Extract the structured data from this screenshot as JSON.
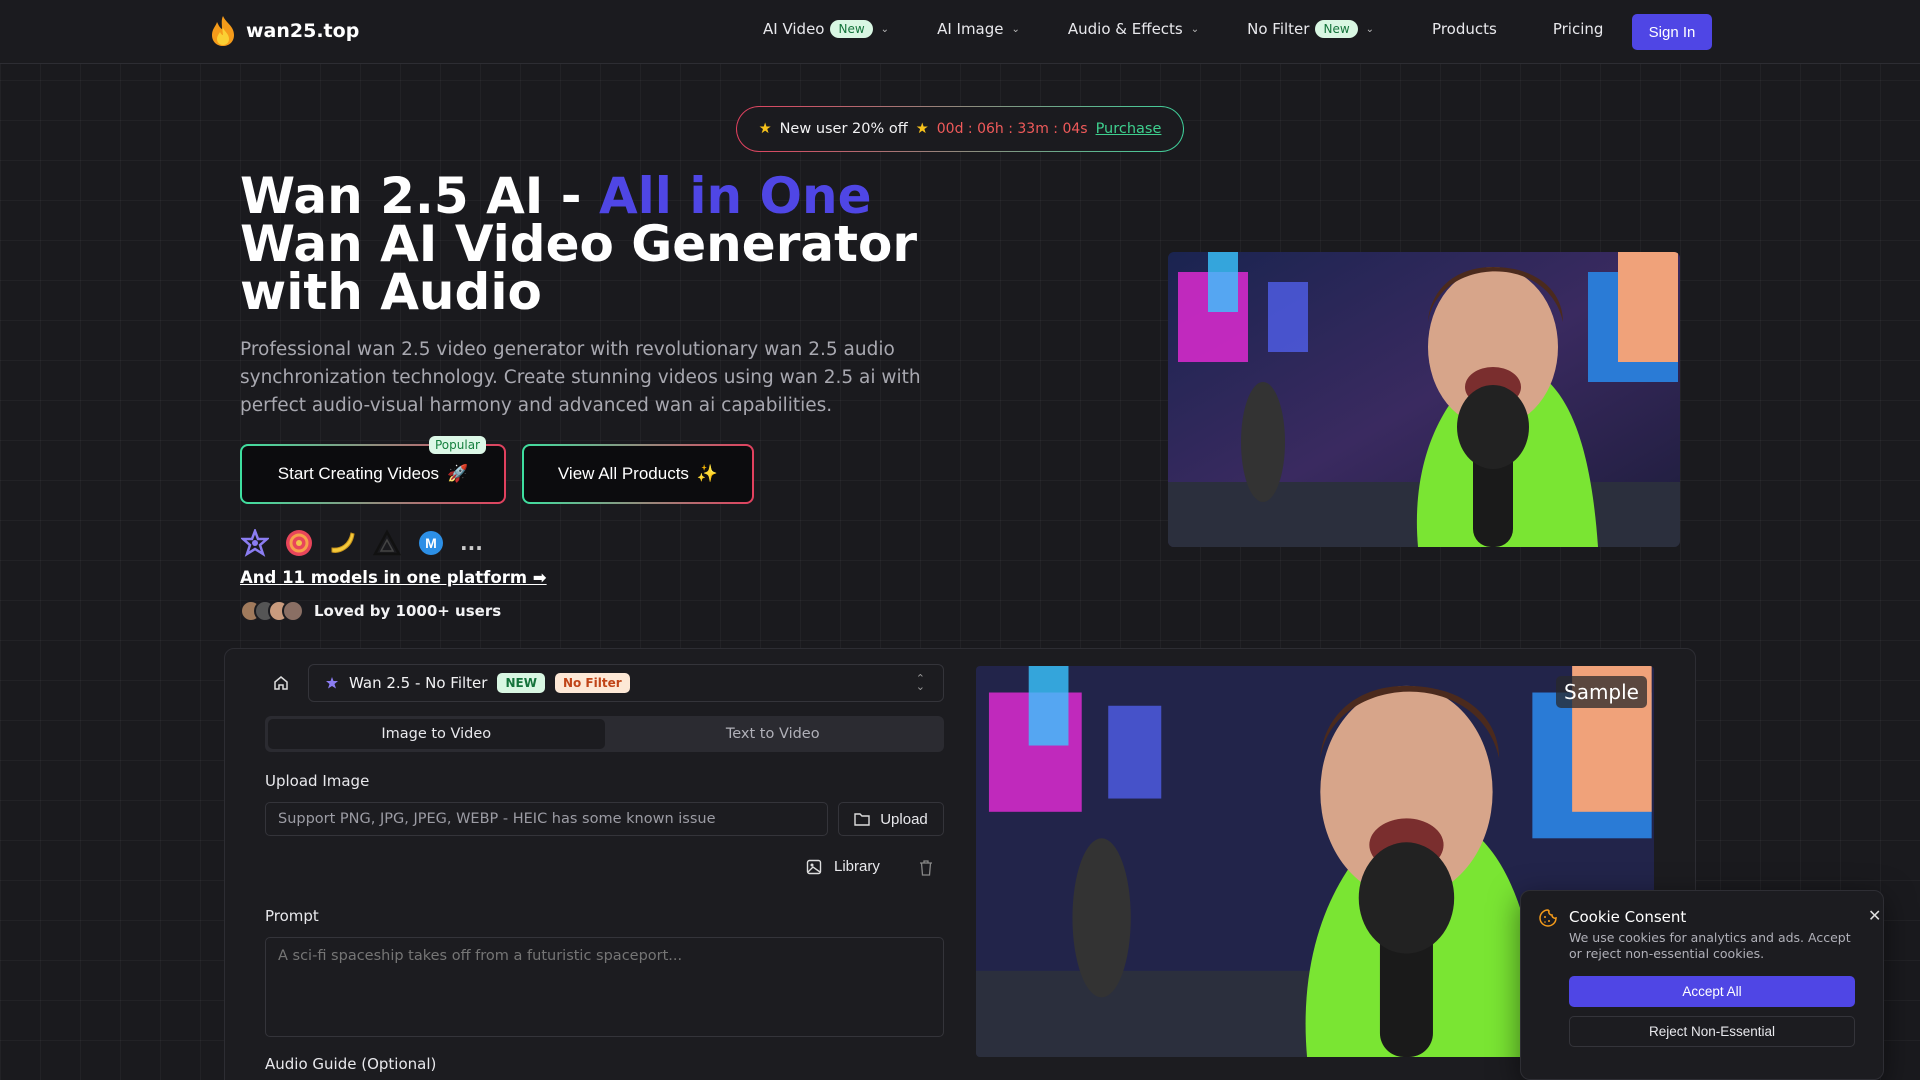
{
  "brand": {
    "name": "wan25.top",
    "icon": "fire-icon"
  },
  "nav": {
    "items": [
      {
        "label": "AI Video",
        "badge": "New",
        "dropdown": true
      },
      {
        "label": "AI Image",
        "badge": "",
        "dropdown": true
      },
      {
        "label": "Audio & Effects",
        "badge": "",
        "dropdown": true
      },
      {
        "label": "No Filter",
        "badge": "New",
        "dropdown": true
      },
      {
        "label": "Products",
        "badge": "",
        "dropdown": false
      },
      {
        "label": "Pricing",
        "badge": "",
        "dropdown": false
      }
    ],
    "signin": "Sign In"
  },
  "promo": {
    "text": "New user 20% off",
    "timer": "00d : 06h : 33m : 04s",
    "link": "Purchase"
  },
  "hero": {
    "title_prefix": "Wan 2.5 AI - ",
    "title_accent": "All in One",
    "title_line2": "Wan AI Video Generator",
    "title_line3": "with Audio",
    "description": "Professional wan 2.5 video generator with revolutionary wan 2.5 audio synchronization technology. Create stunning videos using wan 2.5 ai with perfect audio-visual harmony and advanced wan ai capabilities.",
    "start_button": "Start Creating Videos",
    "start_emoji": "🚀",
    "popular_badge": "Popular",
    "products_button": "View All Products",
    "products_emoji": "✨",
    "model_icons": [
      "star-model-icon",
      "spiral-model-icon",
      "banana-model-icon",
      "triangle-model-icon",
      "m-model-icon"
    ],
    "more": "...",
    "models_link": "And 11 models in one platform ➡",
    "loved": "Loved by 1000+ users"
  },
  "generator": {
    "model_name": "Wan 2.5 - No Filter",
    "tag_new": "NEW",
    "tag_nofilter": "No Filter",
    "tabs": [
      "Image to Video",
      "Text to Video"
    ],
    "active_tab": 0,
    "upload_label": "Upload Image",
    "upload_placeholder": "Support PNG, JPG, JPEG, WEBP - HEIC has some known issue",
    "upload_button": "Upload",
    "library_button": "Library",
    "prompt_label": "Prompt",
    "prompt_placeholder": "A sci-fi spaceship takes off from a futuristic spaceport...",
    "audio_label": "Audio Guide (Optional)",
    "sample_badge": "Sample"
  },
  "cookie": {
    "title": "Cookie Consent",
    "text": "We use cookies for analytics and ads. Accept or reject non-essential cookies.",
    "accept": "Accept All",
    "reject": "Reject Non-Essential"
  },
  "colors": {
    "accent": "#4f46e5",
    "timer": "#f05a5a",
    "link": "#3ecf8e"
  }
}
